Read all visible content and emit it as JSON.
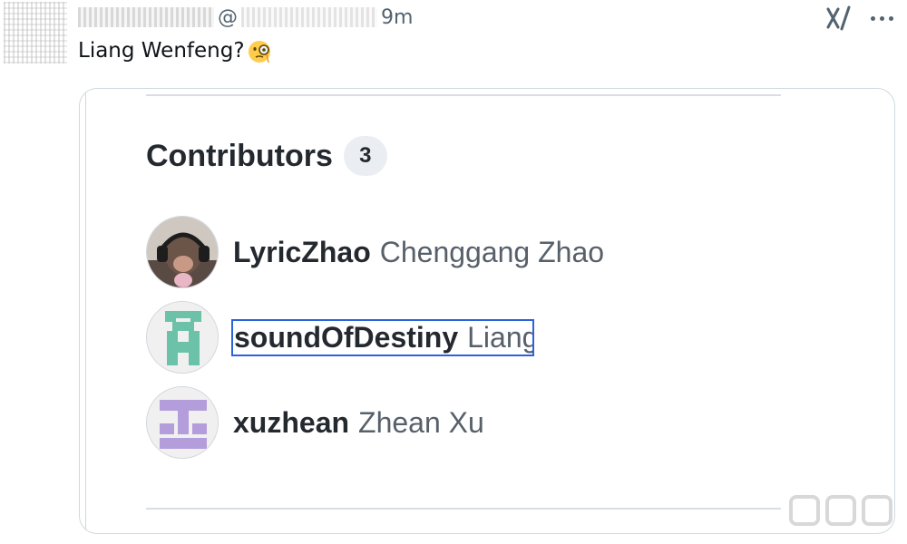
{
  "tweet": {
    "at_sign": "@",
    "time": "9m",
    "text": "Liang Wenfeng?",
    "emoji": "monocle-face"
  },
  "toolbar": {
    "grok_icon": "grok-icon",
    "more_icon": "more-icon"
  },
  "card": {
    "heading": "Contributors",
    "count": "3",
    "contributors": [
      {
        "username": "LyricZhao",
        "fullname": "Chenggang Zhao",
        "avatar": "monkey-headphones-avatar"
      },
      {
        "username": "soundOfDestiny",
        "fullname": "Liang",
        "avatar": "green-identicon-avatar"
      },
      {
        "username": "xuzhean",
        "fullname": "Zhean Xu",
        "avatar": "purple-identicon-avatar"
      }
    ]
  },
  "colors": {
    "focus_outline": "#2b63d9",
    "identicon_green": "#6cc2a8",
    "identicon_purple": "#b39ddb"
  }
}
